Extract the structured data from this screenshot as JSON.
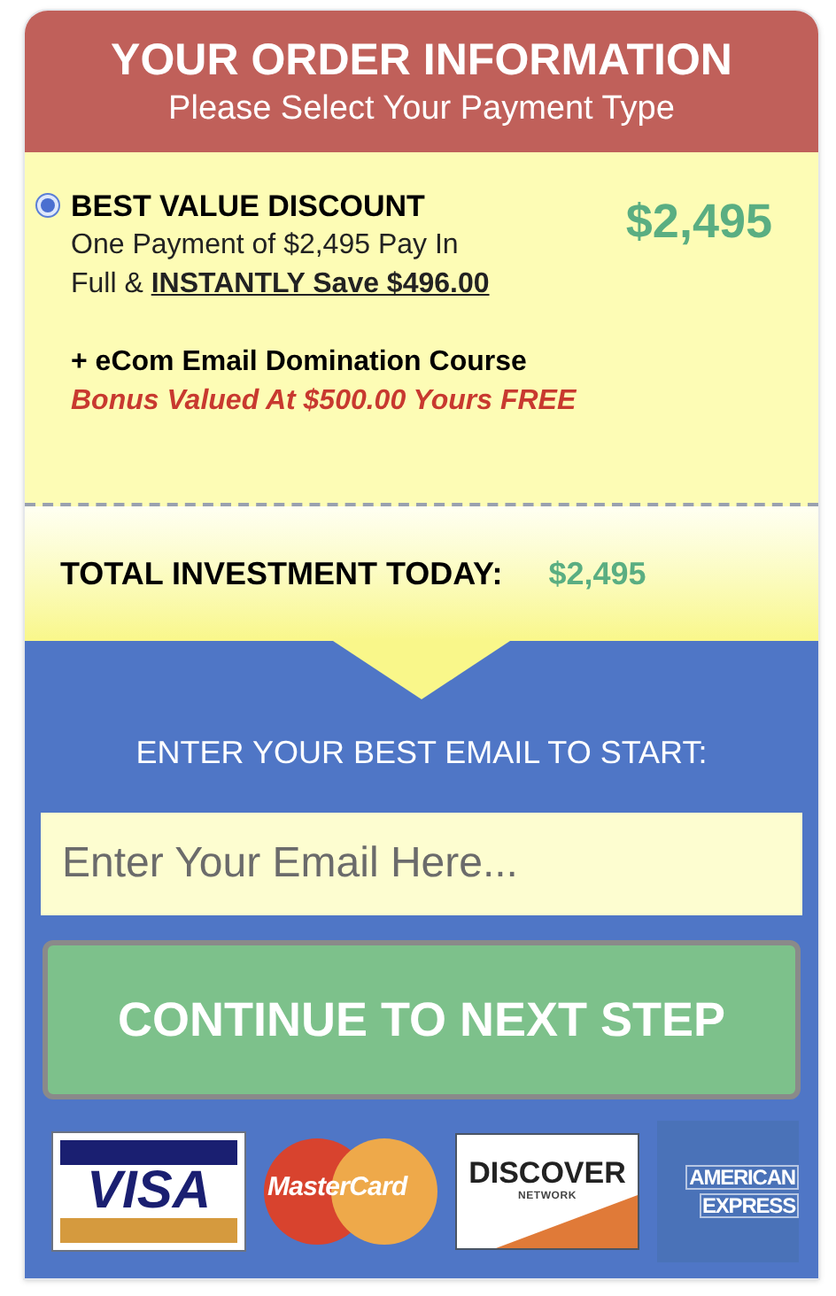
{
  "header": {
    "title": "YOUR ORDER INFORMATION",
    "subtitle": "Please Select Your Payment Type"
  },
  "payment_options": [
    {
      "selected": true,
      "title": "BEST VALUE DISCOUNT",
      "description": "One Payment of $2,495 Pay In Full & **INSTANTLY Save $496.00**",
      "price": "$2,495",
      "bonus_item": "+ eCom Email Domination Course",
      "bonus_note": "Bonus Valued At $500.00 Yours FREE"
    }
  ],
  "total": {
    "label": "TOTAL INVESTMENT TODAY:",
    "amount": "$2,495"
  },
  "email": {
    "label": "ENTER YOUR BEST EMAIL TO START:",
    "placeholder": "Enter Your Email Here..."
  },
  "submit_button": "CONTINUE TO NEXT STEP",
  "card_logos": [
    {
      "kind": "visa",
      "text": [
        "VISA"
      ]
    },
    {
      "kind": "mastercard",
      "text": [
        "MasterCard"
      ]
    },
    {
      "kind": "discover",
      "text": [
        "DISCOVER",
        "NETWORK"
      ]
    },
    {
      "kind": "amex",
      "text": [
        "AMERICAN",
        "EXPRESS"
      ]
    }
  ]
}
